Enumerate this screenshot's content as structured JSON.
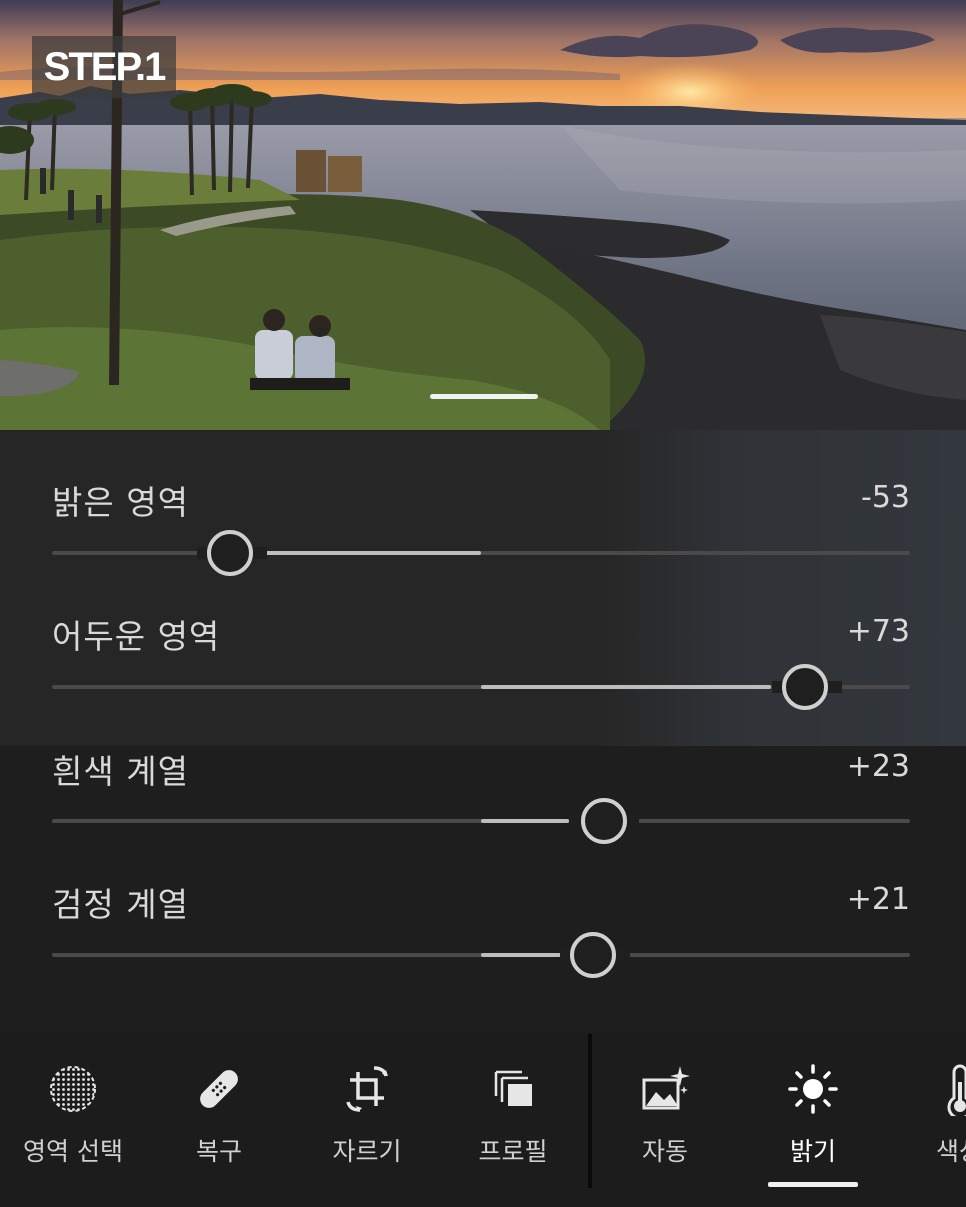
{
  "badge": {
    "text": "STEP.1"
  },
  "adjustments": [
    {
      "label": "밝은 영역",
      "value": "-53",
      "amount": -53
    },
    {
      "label": "어두운 영역",
      "value": "+73",
      "amount": 73
    },
    {
      "label": "흰색 계열",
      "value": "+23",
      "amount": 23
    },
    {
      "label": "검정 계열",
      "value": "+21",
      "amount": 21
    }
  ],
  "toolbar": {
    "tools": [
      {
        "label": "영역 선택",
        "icon": "selective-dotted-circle-icon"
      },
      {
        "label": "복구",
        "icon": "bandage-icon"
      },
      {
        "label": "자르기",
        "icon": "crop-rotate-icon"
      },
      {
        "label": "프로필",
        "icon": "profile-stack-icon"
      },
      {
        "label": "자동",
        "icon": "auto-image-sparkle-icon"
      },
      {
        "label": "밝기",
        "icon": "sun-icon"
      },
      {
        "label": "색상",
        "icon": "thermometer-icon"
      }
    ],
    "active": "밝기"
  },
  "colors": {
    "panel_bg": "#1e1e1e",
    "track": "#4a4a4a",
    "fill": "#bdbdbd",
    "knob": "#cfcfcf"
  }
}
